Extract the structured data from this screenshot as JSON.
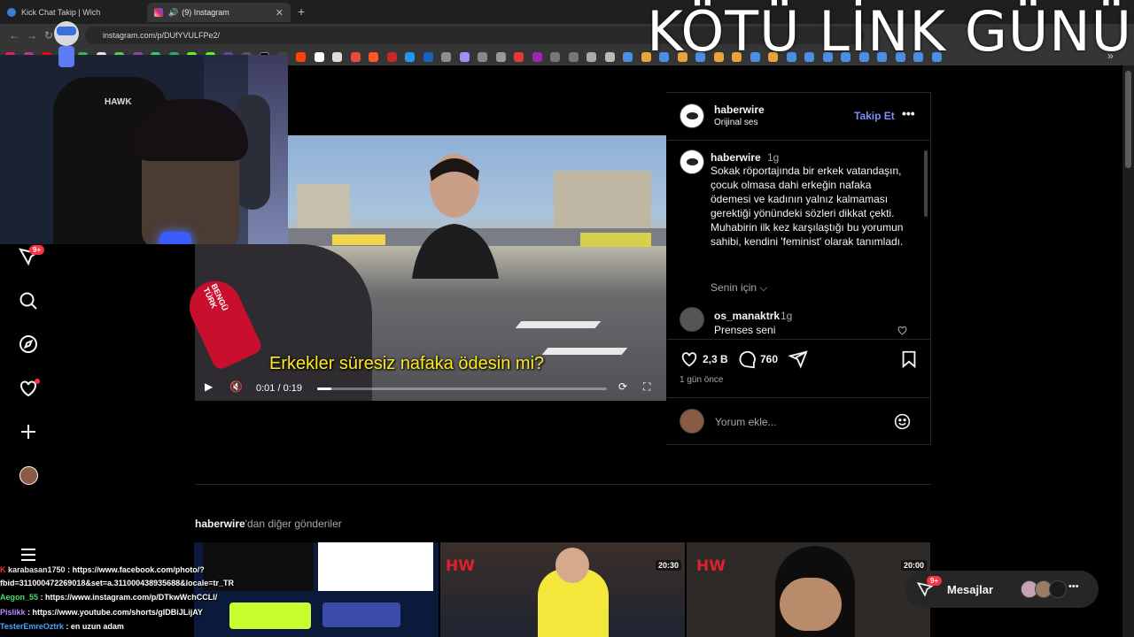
{
  "browser": {
    "tabs": [
      {
        "label": "Kick Chat Takip | Wich",
        "active": false
      },
      {
        "label": "(9) Instagram",
        "active": true
      }
    ],
    "url": "instagram.com/p/DUfYVULFPe2/"
  },
  "overlay": {
    "title": "KÖTÜ LİNK GÜNÜ"
  },
  "sidebar": {
    "notification_badge": "9+",
    "items": [
      "reels-icon",
      "search-icon",
      "explore-icon",
      "notifications-icon",
      "create-icon",
      "profile-icon",
      "menu-icon"
    ]
  },
  "video": {
    "subtitle": "Erkekler süresiz nafaka ödesin mi?",
    "time_current": "0:01",
    "time_total": "0:19",
    "progress": 0.05,
    "mic_brand": "BENGÜ TÜRK"
  },
  "post": {
    "username": "haberwire",
    "audio": "Orijinal ses",
    "follow_label": "Takip Et",
    "caption_user": "haberwire",
    "caption_age": "1g",
    "caption": "Sokak röportajında bir erkek vatandaşın, çocuk olmasa dahi erkeğin nafaka ödemesi ve kadının yalnız kalmaması gerektiği yönündeki sözleri dikkat çekti. Muhabirin ilk kez karşılaştığı bu yorumun sahibi, kendini 'feminist' olarak tanımladı.",
    "for_you": "Senin için",
    "comments": [
      {
        "user": "os_manaktrk",
        "age": "1g",
        "text": "Prenses seni"
      }
    ],
    "likes": "2,3 B",
    "comment_count": "760",
    "posted": "1 gün önce",
    "comment_placeholder": "Yorum ekle..."
  },
  "more_posts": {
    "heading_user": "haberwire",
    "heading_rest": "'dan diğer gönderiler",
    "items": [
      {
        "time": "",
        "logo": "",
        "type": "reel"
      },
      {
        "time": "20:30",
        "logo": "HW"
      },
      {
        "time": "20:00",
        "logo": "HW"
      }
    ]
  },
  "chat": [
    {
      "user": "karabasan1750",
      "text": ": https://www.facebook.com/photo/?fbid=311000472269018&set=a.311000438935688&locale=tr_TR",
      "color": "#e6e6e6"
    },
    {
      "user": "Aegon_55",
      "text": ": https://www.instagram.com/p/DTkwWchCCLI/",
      "color": "#3fe06b"
    },
    {
      "user": "Pislikk",
      "text": ": https://www.youtube.com/shorts/gIDBiJLijAY",
      "color": "#b48cff"
    },
    {
      "user": "TesterEmreOztrk",
      "text": ": en uzun adam",
      "color": "#4aa3ff"
    }
  ],
  "messages": {
    "label": "Mesajlar",
    "badge": "9+"
  },
  "colors": {
    "accent": "#0095f6",
    "follow": "#7c8cf8",
    "badge": "#ff3040",
    "subtitle": "#ffe923"
  }
}
